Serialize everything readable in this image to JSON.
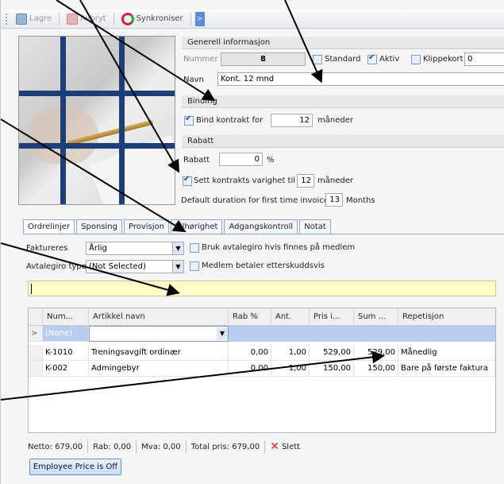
{
  "toolbar": {
    "save": "Lagre",
    "cancel": "Avbryt",
    "sync": "Synkroniser",
    "more": ">"
  },
  "general": {
    "header": "Generell informasjon",
    "number_label": "Nummer",
    "number_value": "8",
    "standard_label": "Standard",
    "active_label": "Aktiv",
    "punchcard_label": "Klippekort",
    "punchcard_value": "0",
    "name_label": "Navn",
    "name_value": "Kont. 12 mnd"
  },
  "binding": {
    "header": "Binding",
    "bind_label": "Bind kontrakt for",
    "bind_value": "12",
    "bind_unit": "måneder"
  },
  "discount": {
    "header": "Rabatt",
    "label": "Rabatt",
    "value": "0",
    "unit": "%",
    "set_duration_label": "Sett kontrakts varighet til",
    "duration_value": "12",
    "duration_unit": "måneder",
    "default_duration_label": "Default duration for first time invoice",
    "default_duration_value": "13",
    "default_duration_unit": "Months"
  },
  "tabs": [
    "Ordrelinjer",
    "Sponsing",
    "Provisjon",
    "Tilhørighet",
    "Adgangskontroll",
    "Notat"
  ],
  "order": {
    "invoiced_label": "Faktureres",
    "invoiced_value": "Årlig",
    "avtalegiro_type_label": "Avtalegiro type",
    "avtalegiro_type_value": "(Not Selected)",
    "use_avtalegiro_label": "Bruk avtalegiro hvis finnes på medlem",
    "member_pays_label": "Medlem betaler etterskuddsvis",
    "filter_value": ""
  },
  "grid": {
    "columns": [
      "Num...",
      "Artikkel navn",
      "Rab %",
      "Ant.",
      "Pris i...",
      "Sum ...",
      "Repetisjon"
    ],
    "new_row": {
      "indicator": ">",
      "num": "(None)",
      "name": ""
    },
    "rows": [
      {
        "num": "K-1010",
        "name": "Treningsavgift ordinær",
        "discount": "0,00",
        "qty": "1,00",
        "price": "529,00",
        "sum": "529,00",
        "repeat": "Månedlig"
      },
      {
        "num": "K-002",
        "name": "Admingebyr",
        "discount": "0,00",
        "qty": "1,00",
        "price": "150,00",
        "sum": "150,00",
        "repeat": "Bare på første faktura"
      }
    ]
  },
  "footer": {
    "net": "Netto:  679,00",
    "discount": "Rab:  0,00",
    "vat": "Mva:  0,00",
    "total": "Total pris:  679,00",
    "delete": "Slett"
  },
  "employee_price_button": "Employee Price is Off",
  "colors": {
    "accent": "#1b4fa6",
    "highlight_row": "#b9cdf0",
    "filter_bg": "#ffffc8",
    "photo_grid": "#1c3f7a"
  }
}
